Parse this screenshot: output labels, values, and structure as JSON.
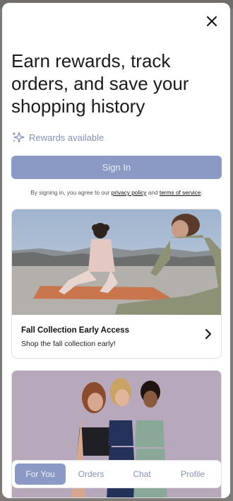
{
  "header": {
    "headline": "Earn rewards, track orders, and save your shopping history"
  },
  "rewards": {
    "label": "Rewards available",
    "icon": "sparkle-icon"
  },
  "signin": {
    "button_label": "Sign In"
  },
  "terms": {
    "prefix": "By signing in, you agree to our ",
    "privacy_link": "privacy policy",
    "middle": " and ",
    "terms_link": "terms of service",
    "suffix": "."
  },
  "promo_card": {
    "title": "Fall Collection Early Access",
    "subtitle": "Shop the fall collection early!"
  },
  "tabs": [
    {
      "label": "For You",
      "active": true
    },
    {
      "label": "Orders",
      "active": false
    },
    {
      "label": "Chat",
      "active": false
    },
    {
      "label": "Profile",
      "active": false
    }
  ],
  "colors": {
    "accent": "#8b9ac4",
    "accent_text": "#8592b8"
  }
}
